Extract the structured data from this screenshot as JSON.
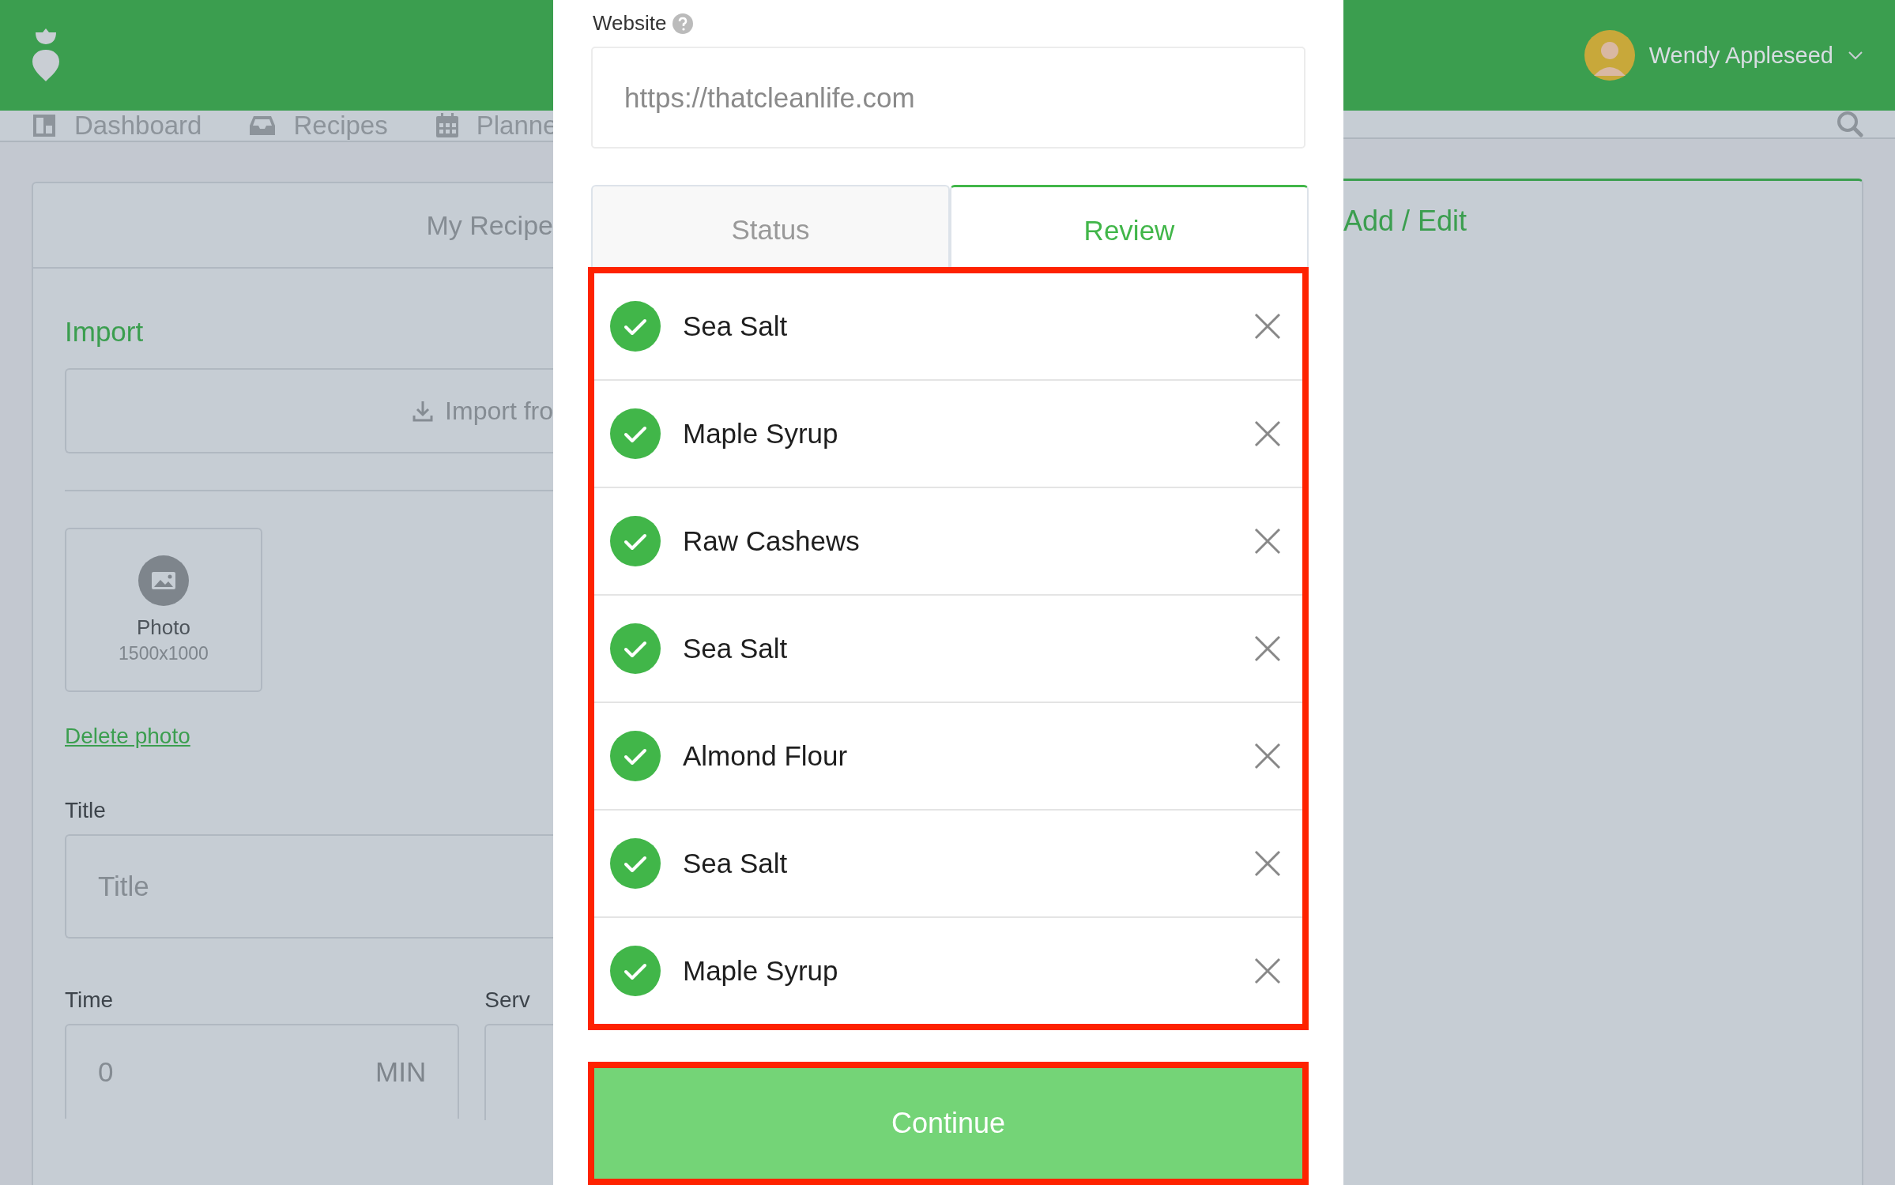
{
  "header": {
    "user_name": "Wendy Appleseed"
  },
  "nav": {
    "items": [
      {
        "label": "Dashboard",
        "kind": "dashboard"
      },
      {
        "label": "Recipes",
        "kind": "inbox"
      },
      {
        "label": "Planne",
        "kind": "calendar"
      }
    ]
  },
  "recipe_card": {
    "tab": "My Recipe",
    "import_heading": "Import",
    "import_button": "Import fro",
    "photo": {
      "label": "Photo",
      "size": "1500x1000"
    },
    "delete_link": "Delete photo",
    "title_label": "Title",
    "title_placeholder": "Title",
    "time_label": "Time",
    "time_placeholder": "0",
    "time_unit": "MIN",
    "servings_label": "Serv"
  },
  "edit_card": {
    "heading": "Add / Edit"
  },
  "modal": {
    "website_label": "Website",
    "website_placeholder": "https://thatcleanlife.com",
    "tabs": [
      {
        "label": "Status",
        "selected": false
      },
      {
        "label": "Review",
        "selected": true
      }
    ],
    "ingredients": [
      {
        "name": "Sea Salt",
        "checked": true
      },
      {
        "name": "Maple Syrup",
        "checked": true
      },
      {
        "name": "Raw Cashews",
        "checked": true
      },
      {
        "name": "Sea Salt",
        "checked": true
      },
      {
        "name": "Almond Flour",
        "checked": true
      },
      {
        "name": "Sea Salt",
        "checked": true
      },
      {
        "name": "Maple Syrup",
        "checked": true
      }
    ],
    "continue_button": "Continue"
  }
}
